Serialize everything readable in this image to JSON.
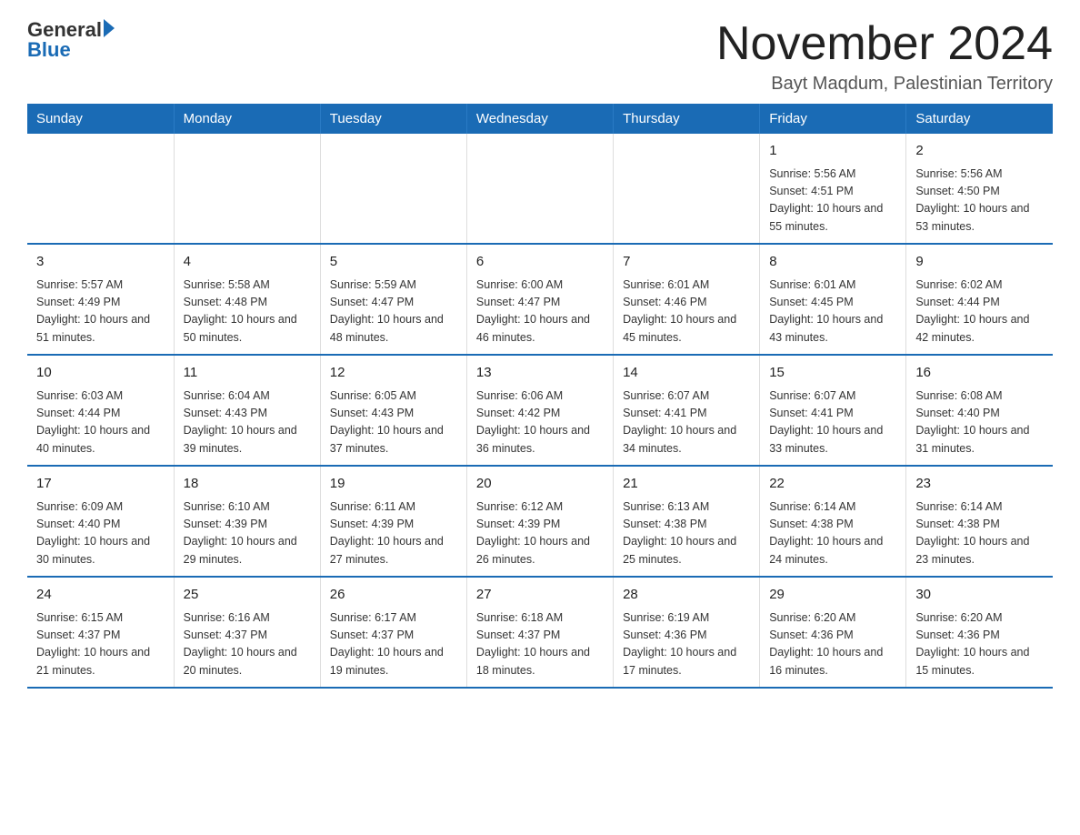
{
  "header": {
    "logo_general": "General",
    "logo_blue": "Blue",
    "title": "November 2024",
    "subtitle": "Bayt Maqdum, Palestinian Territory"
  },
  "days_of_week": [
    "Sunday",
    "Monday",
    "Tuesday",
    "Wednesday",
    "Thursday",
    "Friday",
    "Saturday"
  ],
  "weeks": [
    {
      "days": [
        {
          "number": "",
          "info": ""
        },
        {
          "number": "",
          "info": ""
        },
        {
          "number": "",
          "info": ""
        },
        {
          "number": "",
          "info": ""
        },
        {
          "number": "",
          "info": ""
        },
        {
          "number": "1",
          "info": "Sunrise: 5:56 AM\nSunset: 4:51 PM\nDaylight: 10 hours and 55 minutes."
        },
        {
          "number": "2",
          "info": "Sunrise: 5:56 AM\nSunset: 4:50 PM\nDaylight: 10 hours and 53 minutes."
        }
      ]
    },
    {
      "days": [
        {
          "number": "3",
          "info": "Sunrise: 5:57 AM\nSunset: 4:49 PM\nDaylight: 10 hours and 51 minutes."
        },
        {
          "number": "4",
          "info": "Sunrise: 5:58 AM\nSunset: 4:48 PM\nDaylight: 10 hours and 50 minutes."
        },
        {
          "number": "5",
          "info": "Sunrise: 5:59 AM\nSunset: 4:47 PM\nDaylight: 10 hours and 48 minutes."
        },
        {
          "number": "6",
          "info": "Sunrise: 6:00 AM\nSunset: 4:47 PM\nDaylight: 10 hours and 46 minutes."
        },
        {
          "number": "7",
          "info": "Sunrise: 6:01 AM\nSunset: 4:46 PM\nDaylight: 10 hours and 45 minutes."
        },
        {
          "number": "8",
          "info": "Sunrise: 6:01 AM\nSunset: 4:45 PM\nDaylight: 10 hours and 43 minutes."
        },
        {
          "number": "9",
          "info": "Sunrise: 6:02 AM\nSunset: 4:44 PM\nDaylight: 10 hours and 42 minutes."
        }
      ]
    },
    {
      "days": [
        {
          "number": "10",
          "info": "Sunrise: 6:03 AM\nSunset: 4:44 PM\nDaylight: 10 hours and 40 minutes."
        },
        {
          "number": "11",
          "info": "Sunrise: 6:04 AM\nSunset: 4:43 PM\nDaylight: 10 hours and 39 minutes."
        },
        {
          "number": "12",
          "info": "Sunrise: 6:05 AM\nSunset: 4:43 PM\nDaylight: 10 hours and 37 minutes."
        },
        {
          "number": "13",
          "info": "Sunrise: 6:06 AM\nSunset: 4:42 PM\nDaylight: 10 hours and 36 minutes."
        },
        {
          "number": "14",
          "info": "Sunrise: 6:07 AM\nSunset: 4:41 PM\nDaylight: 10 hours and 34 minutes."
        },
        {
          "number": "15",
          "info": "Sunrise: 6:07 AM\nSunset: 4:41 PM\nDaylight: 10 hours and 33 minutes."
        },
        {
          "number": "16",
          "info": "Sunrise: 6:08 AM\nSunset: 4:40 PM\nDaylight: 10 hours and 31 minutes."
        }
      ]
    },
    {
      "days": [
        {
          "number": "17",
          "info": "Sunrise: 6:09 AM\nSunset: 4:40 PM\nDaylight: 10 hours and 30 minutes."
        },
        {
          "number": "18",
          "info": "Sunrise: 6:10 AM\nSunset: 4:39 PM\nDaylight: 10 hours and 29 minutes."
        },
        {
          "number": "19",
          "info": "Sunrise: 6:11 AM\nSunset: 4:39 PM\nDaylight: 10 hours and 27 minutes."
        },
        {
          "number": "20",
          "info": "Sunrise: 6:12 AM\nSunset: 4:39 PM\nDaylight: 10 hours and 26 minutes."
        },
        {
          "number": "21",
          "info": "Sunrise: 6:13 AM\nSunset: 4:38 PM\nDaylight: 10 hours and 25 minutes."
        },
        {
          "number": "22",
          "info": "Sunrise: 6:14 AM\nSunset: 4:38 PM\nDaylight: 10 hours and 24 minutes."
        },
        {
          "number": "23",
          "info": "Sunrise: 6:14 AM\nSunset: 4:38 PM\nDaylight: 10 hours and 23 minutes."
        }
      ]
    },
    {
      "days": [
        {
          "number": "24",
          "info": "Sunrise: 6:15 AM\nSunset: 4:37 PM\nDaylight: 10 hours and 21 minutes."
        },
        {
          "number": "25",
          "info": "Sunrise: 6:16 AM\nSunset: 4:37 PM\nDaylight: 10 hours and 20 minutes."
        },
        {
          "number": "26",
          "info": "Sunrise: 6:17 AM\nSunset: 4:37 PM\nDaylight: 10 hours and 19 minutes."
        },
        {
          "number": "27",
          "info": "Sunrise: 6:18 AM\nSunset: 4:37 PM\nDaylight: 10 hours and 18 minutes."
        },
        {
          "number": "28",
          "info": "Sunrise: 6:19 AM\nSunset: 4:36 PM\nDaylight: 10 hours and 17 minutes."
        },
        {
          "number": "29",
          "info": "Sunrise: 6:20 AM\nSunset: 4:36 PM\nDaylight: 10 hours and 16 minutes."
        },
        {
          "number": "30",
          "info": "Sunrise: 6:20 AM\nSunset: 4:36 PM\nDaylight: 10 hours and 15 minutes."
        }
      ]
    }
  ]
}
